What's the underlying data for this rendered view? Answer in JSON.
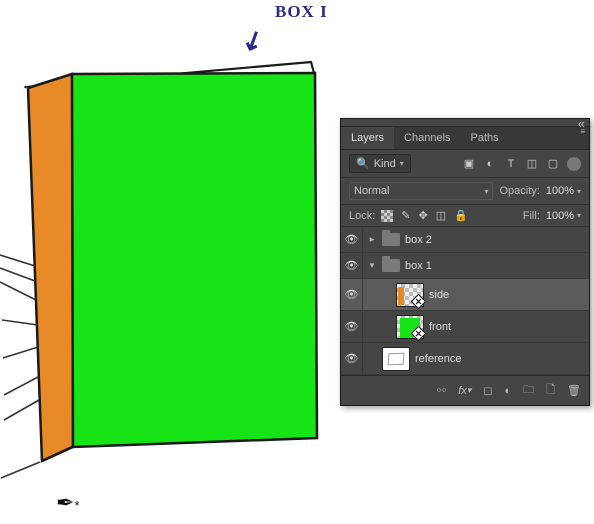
{
  "annotation": {
    "label": "BOX I"
  },
  "panel": {
    "tabs": [
      "Layers",
      "Channels",
      "Paths"
    ],
    "active_tab": 0,
    "filter": {
      "label": "Kind"
    },
    "blend": {
      "mode": "Normal",
      "opacity_label": "Opacity:",
      "opacity_value": "100%"
    },
    "lock": {
      "label": "Lock:",
      "fill_label": "Fill:",
      "fill_value": "100%"
    },
    "filter_icons": [
      "image-icon",
      "adjustment-icon",
      "type-icon",
      "shape-icon",
      "smart-icon"
    ],
    "lock_icons": [
      "transparency-lock-icon",
      "brush-lock-icon",
      "position-lock-icon",
      "artboard-lock-icon",
      "all-lock-icon"
    ],
    "footer_icons": [
      "link-icon",
      "fx-icon",
      "mask-icon",
      "adjustment-layer-icon",
      "group-icon",
      "new-layer-icon",
      "trash-icon"
    ],
    "layers": [
      {
        "type": "group",
        "name": "box 2",
        "expanded": false,
        "depth": 0
      },
      {
        "type": "group",
        "name": "box 1",
        "expanded": true,
        "depth": 0
      },
      {
        "type": "layer",
        "name": "side",
        "thumb": "orange",
        "selected": true,
        "smart": true,
        "depth": 1
      },
      {
        "type": "layer",
        "name": "front",
        "thumb": "green",
        "smart": true,
        "depth": 1
      },
      {
        "type": "layer",
        "name": "reference",
        "thumb": "sketch",
        "depth": 0
      }
    ]
  },
  "colors": {
    "box_front": "#17e417",
    "box_side": "#e98a29",
    "outline": "#1a1a1a",
    "panel_bg": "#454545"
  }
}
